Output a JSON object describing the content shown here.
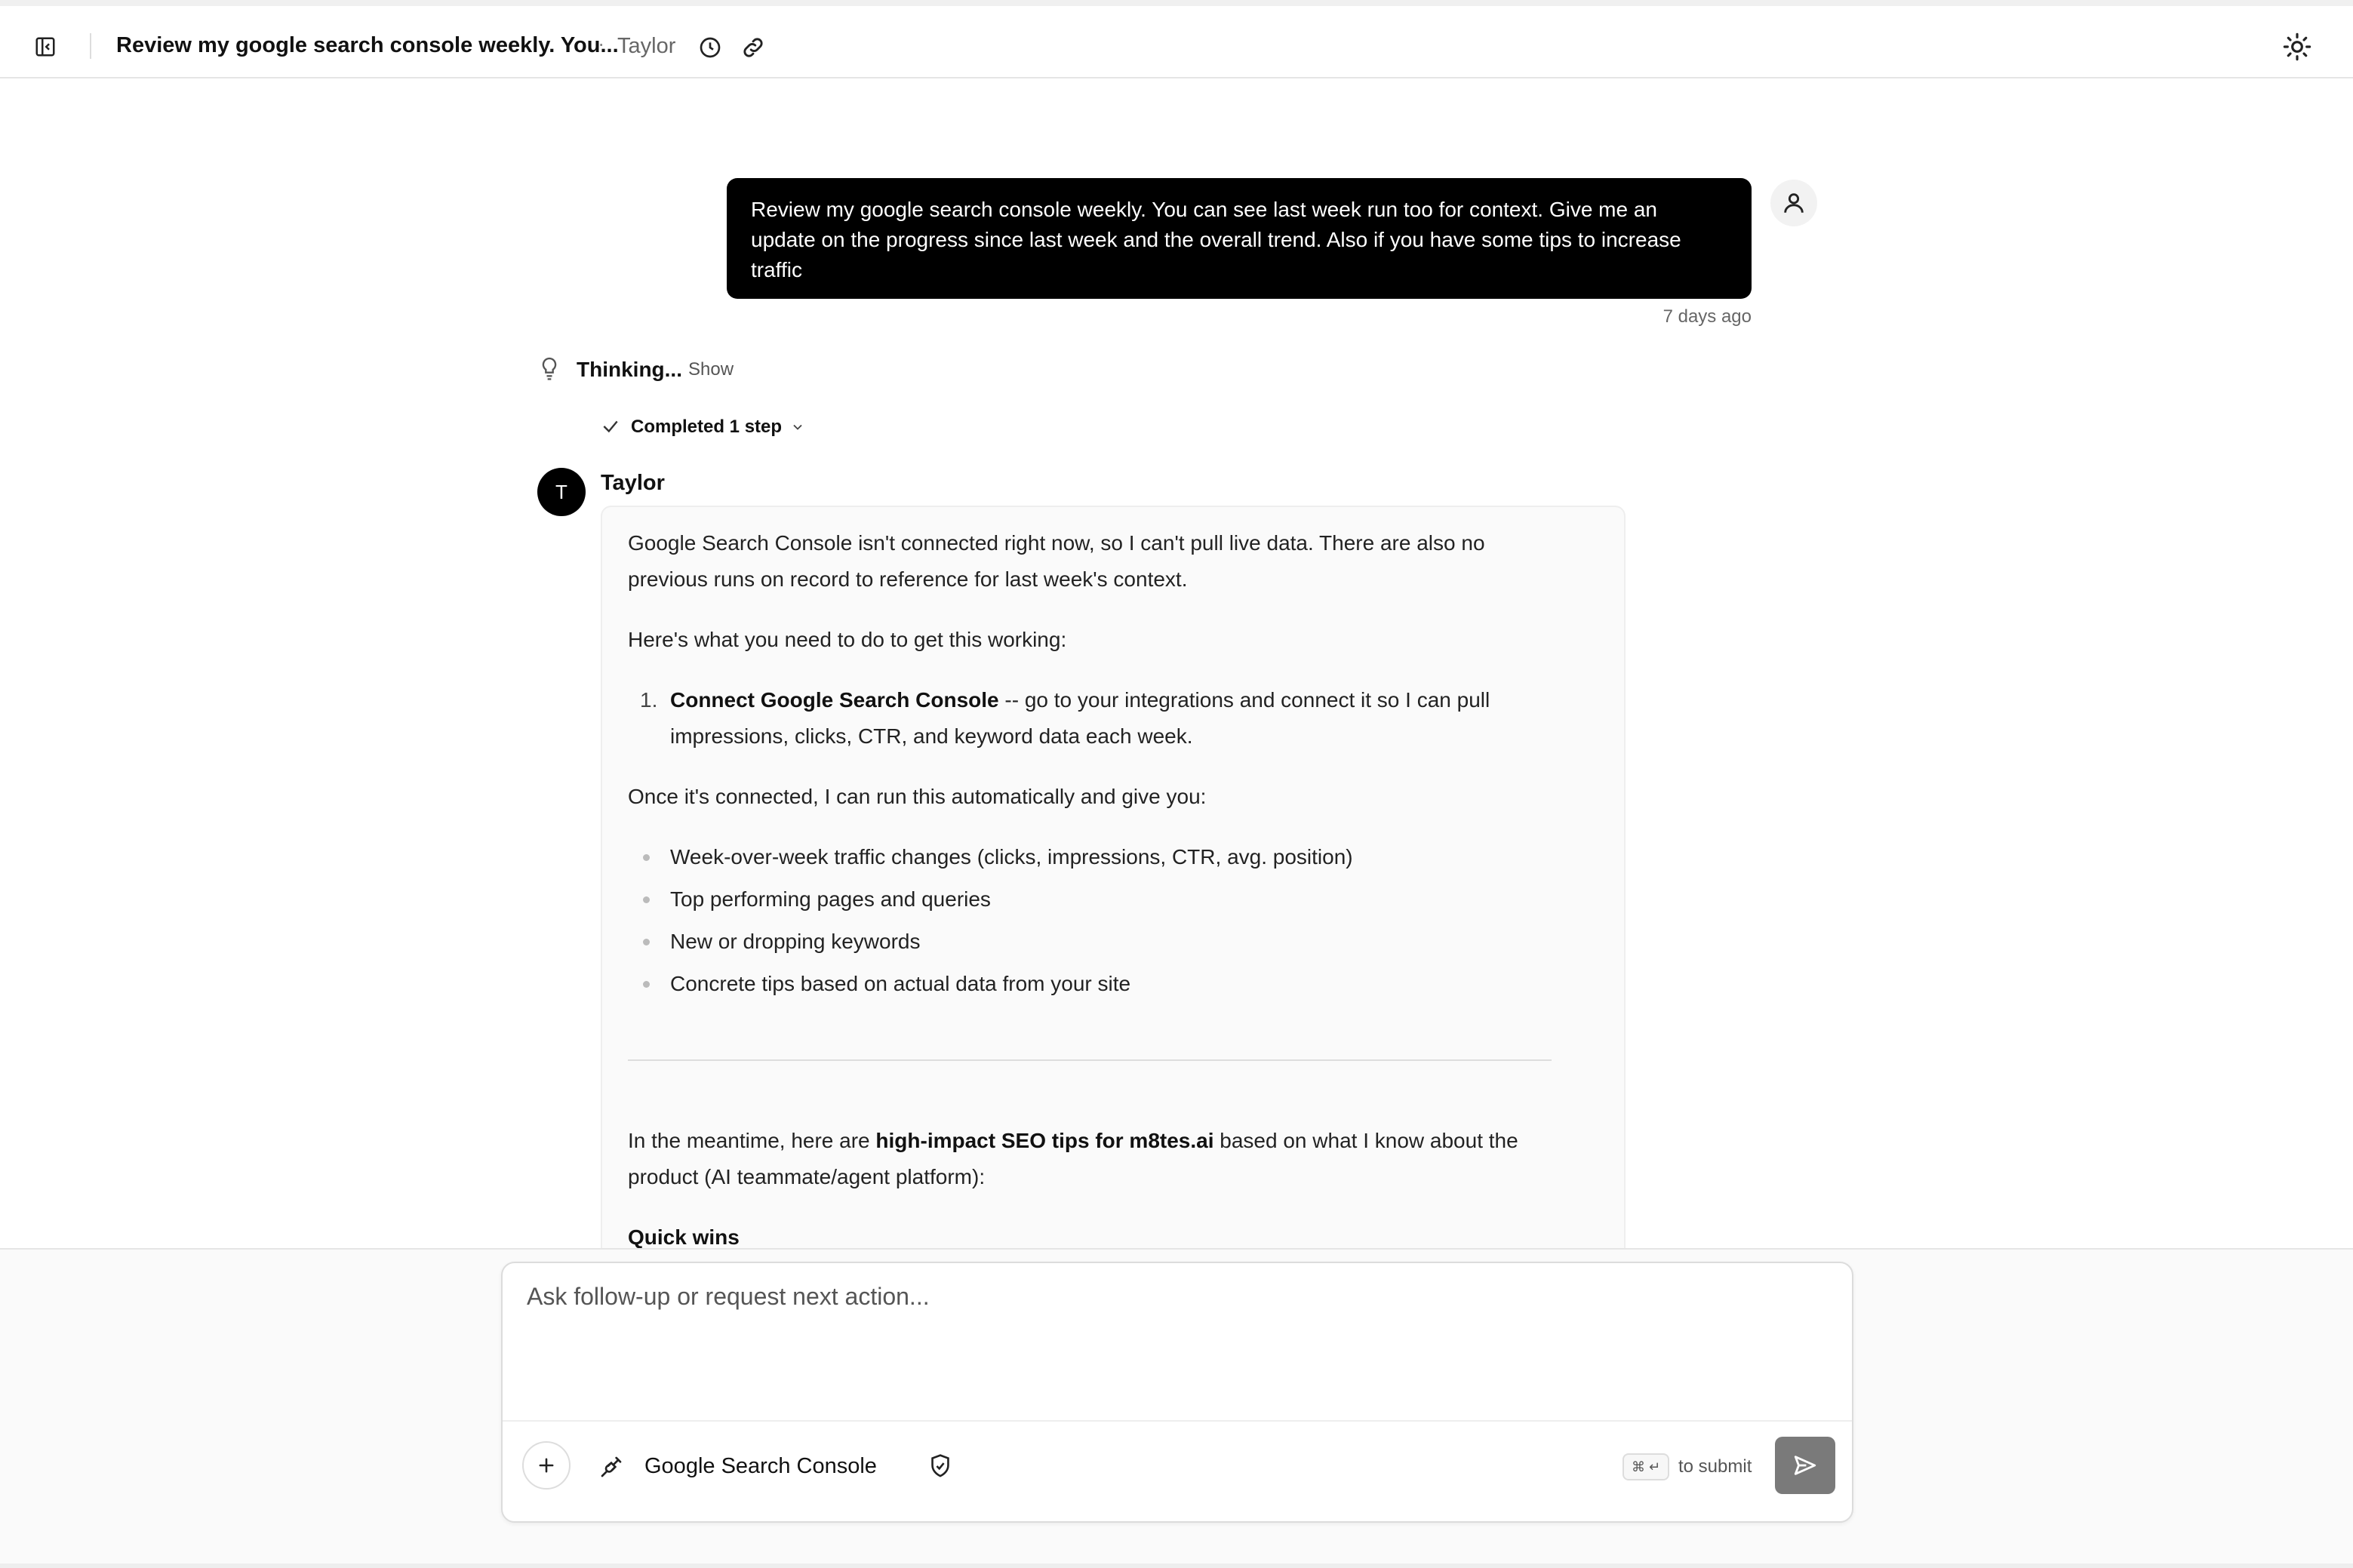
{
  "header": {
    "title": "Review my google search console weekly. You...",
    "separator": "·",
    "user": "Taylor",
    "icons": [
      "sidebar-toggle-icon",
      "history-icon",
      "link-icon",
      "sun-icon"
    ]
  },
  "user_message": {
    "text": "Review my google search console weekly. You can see last week run too for context. Give me an update on the progress since last week and the overall trend. Also if you have some tips to increase traffic",
    "time": "7 days ago"
  },
  "thinking": {
    "label": "Thinking...",
    "toggle": "Show",
    "steps": "Completed 1 step"
  },
  "assistant": {
    "avatar_letter": "T",
    "name": "Taylor",
    "intro": "Google Search Console isn't connected right now, so I can't pull live data. There are also no previous runs on record to reference for last week's context.",
    "need_heading": "Here's what you need to do to get this working:",
    "step_number": "1.",
    "step_bold": "Connect Google Search Console",
    "step_rest": " -- go to your integrations and connect it so I can pull impressions, clicks, CTR, and keyword data each week.",
    "once_connected": "Once it's connected, I can run this automatically and give you:",
    "bullets": [
      "Week-over-week traffic changes (clicks, impressions, CTR, avg. position)",
      "Top performing pages and queries",
      "New or dropping keywords",
      "Concrete tips based on actual data from your site"
    ],
    "meantime_before": "In the meantime, here are ",
    "meantime_bold": "high-impact SEO tips for m8tes.ai",
    "meantime_after": " based on what I know about the product (AI teammate/agent platform):",
    "quick_wins": "Quick wins"
  },
  "composer": {
    "placeholder": "Ask follow-up or request next action...",
    "integration": "Google Search Console",
    "kbd": "⌘ ↵",
    "submit_hint": "to submit"
  },
  "colors": {
    "user_bubble": "#000000",
    "avatar": "#000000",
    "send_button": "#7a7a7a",
    "card_background": "#fafafa"
  }
}
